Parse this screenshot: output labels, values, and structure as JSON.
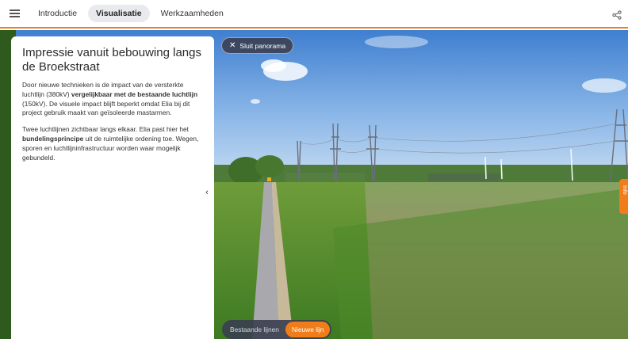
{
  "nav": {
    "tabs": [
      {
        "label": "Introductie"
      },
      {
        "label": "Visualisatie"
      },
      {
        "label": "Werkzaamheden"
      }
    ]
  },
  "panel": {
    "title": "Impressie vanuit bebouwing langs de Broekstraat",
    "p1_a": "Door nieuwe technieken is de impact van de versterkte luchtlijn (380kV) ",
    "p1_b": "vergelijkbaar met de bestaande luchtlijn",
    "p1_c": " (150kV). De visuele impact blijft beperkt omdat Elia bij dit project gebruik maakt van geïsoleerde mastarmen.",
    "p2_a": "Twee luchtlijnen zichtbaar langs elkaar. Elia past hier het ",
    "p2_b": "bundelingsprincipe",
    "p2_c": " uit de ruimtelijke ordening toe. Wegen, sporen en luchtlijninfrastructuur worden waar mogelijk gebundeld."
  },
  "panorama": {
    "close_label": "Sluit panorama",
    "toggle": {
      "options": [
        "Bestaande lijnen",
        "Nieuwe lijn"
      ],
      "selected": "Nieuwe lijn"
    },
    "side_tab_label": "Info"
  },
  "colors": {
    "accent": "#f07d19",
    "dark_chip": "#3a3e50"
  }
}
